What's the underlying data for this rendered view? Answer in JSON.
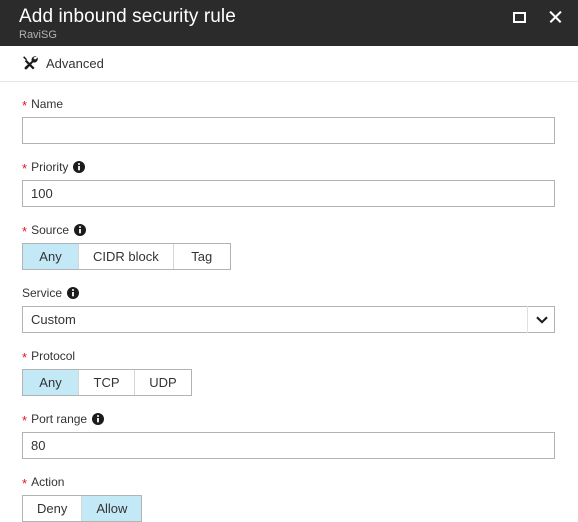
{
  "titlebar": {
    "title": "Add inbound security rule",
    "subtitle": "RaviSG",
    "maximize_icon": "maximize-icon",
    "close_icon": "close-icon"
  },
  "commandbar": {
    "advanced_label": "Advanced",
    "advanced_icon": "tools-icon"
  },
  "form": {
    "name": {
      "label": "Name",
      "required": true,
      "value": "",
      "placeholder": ""
    },
    "priority": {
      "label": "Priority",
      "required": true,
      "has_info": true,
      "value": "100"
    },
    "source": {
      "label": "Source",
      "required": true,
      "has_info": true,
      "options": [
        "Any",
        "CIDR block",
        "Tag"
      ],
      "selected": "Any"
    },
    "service": {
      "label": "Service",
      "required": false,
      "has_info": true,
      "value": "Custom",
      "options": [
        "Custom"
      ]
    },
    "protocol": {
      "label": "Protocol",
      "required": true,
      "has_info": false,
      "options": [
        "Any",
        "TCP",
        "UDP"
      ],
      "selected": "Any"
    },
    "port_range": {
      "label": "Port range",
      "required": true,
      "has_info": true,
      "value": "80"
    },
    "action": {
      "label": "Action",
      "required": true,
      "has_info": false,
      "options": [
        "Deny",
        "Allow"
      ],
      "selected": "Allow"
    }
  },
  "colors": {
    "titlebar_bg": "#2b2b2b",
    "accent_selected": "#c3e9f7",
    "required_star": "#e81123",
    "border": "#b3b3b3",
    "text": "#333333"
  }
}
